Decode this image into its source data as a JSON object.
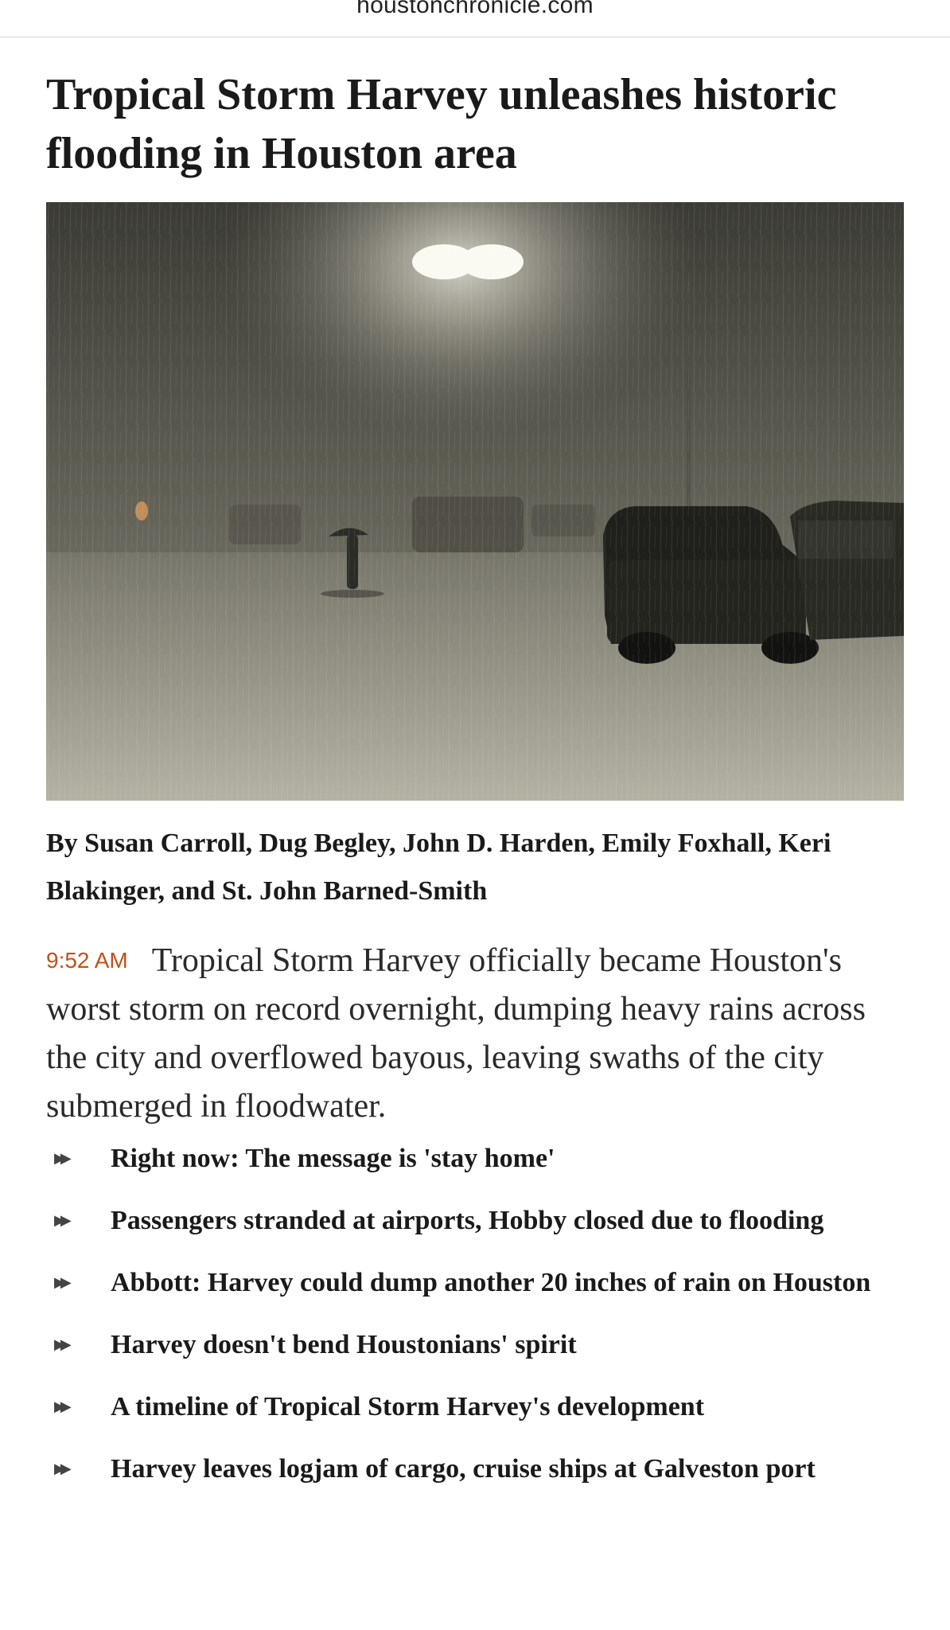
{
  "browser": {
    "url": "houstonchronicle.com"
  },
  "article": {
    "headline": "Tropical Storm Harvey unleashes historic flooding in Houston area",
    "byline": "By Susan Carroll, Dug Begley, John D. Harden, Emily Foxhall, Keri Blakinger, and St. John Barned-Smith",
    "timestamp": "9:52 AM",
    "lede": "Tropical Storm Harvey officially became Houston's worst storm on record overnight, dumping heavy rains across the city and overflowed bayous, leaving swaths of the city submerged in floodwater.",
    "related_links": [
      {
        "label": "Right now: The message is 'stay home'",
        "icon": "double-chevron-right-icon"
      },
      {
        "label": "Passengers stranded at airports, Hobby closed due to flooding",
        "icon": "double-chevron-right-icon"
      },
      {
        "label": "Abbott: Harvey could dump another 20 inches of rain on Houston",
        "icon": "double-chevron-right-icon"
      },
      {
        "label": "Harvey doesn't bend Houstonians' spirit",
        "icon": "double-chevron-right-icon"
      },
      {
        "label": "A timeline of Tropical Storm Harvey's development",
        "icon": "double-chevron-right-icon"
      },
      {
        "label": "Harvey leaves logjam of cargo, cruise ships at Galveston port",
        "icon": "double-chevron-right-icon"
      }
    ]
  },
  "colors": {
    "timestamp": "#c4501b",
    "headline": "#1a1a1a",
    "body_text": "#2a2a2a"
  }
}
